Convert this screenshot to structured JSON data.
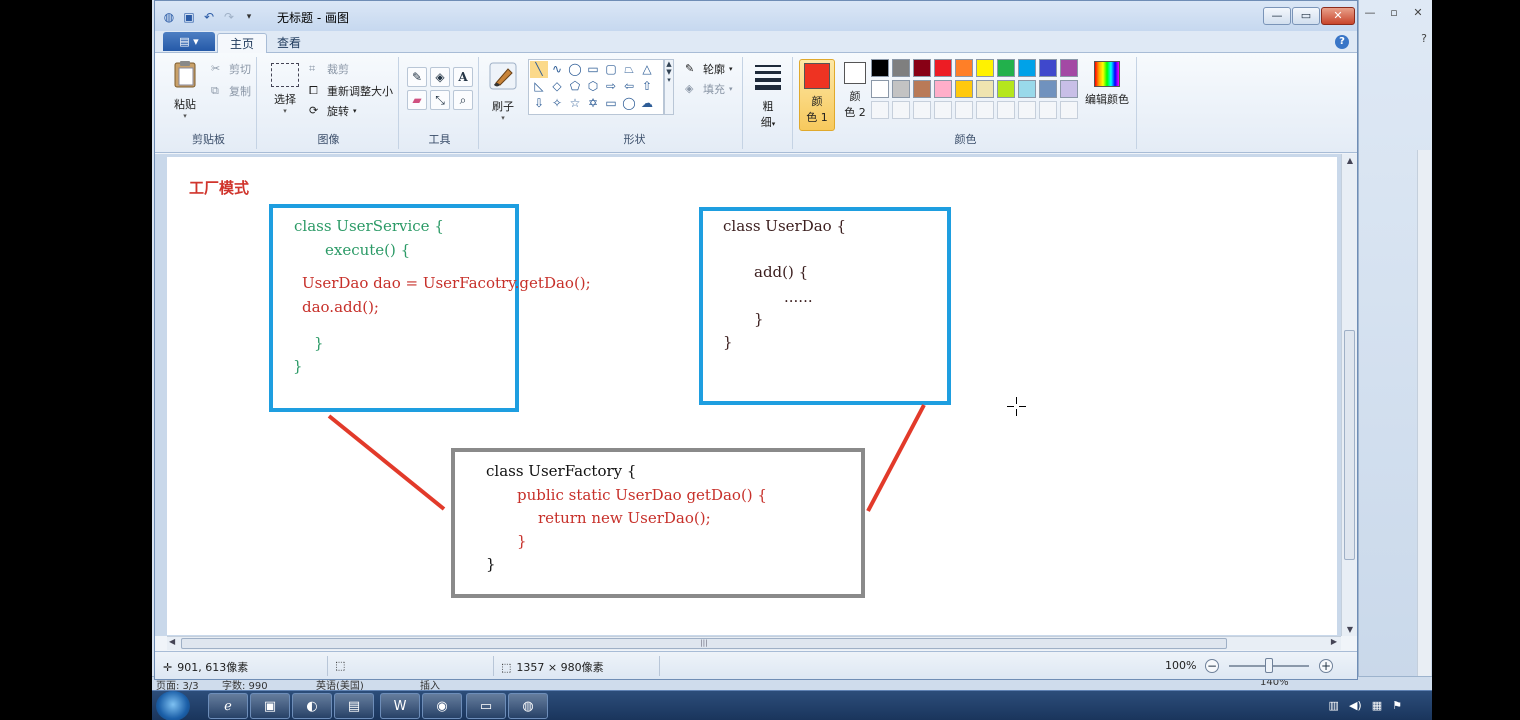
{
  "window": {
    "title": "无标题 - 画图",
    "qat_icons": [
      "paint-app-icon",
      "save-icon",
      "undo-icon",
      "redo-icon",
      "customize-qat-icon"
    ]
  },
  "tabs": [
    {
      "label": "主页",
      "active": true
    },
    {
      "label": "查看",
      "active": false
    }
  ],
  "ribbon": {
    "clipboard": {
      "paste": "粘贴",
      "cut": "剪切",
      "copy": "复制",
      "group": "剪贴板"
    },
    "image": {
      "select": "选择",
      "crop": "裁剪",
      "resize": "重新调整大小",
      "rotate": "旋转",
      "group": "图像"
    },
    "tools": {
      "group": "工具"
    },
    "brushes": {
      "label": "刷子"
    },
    "shapes": {
      "outline": "轮廓",
      "fill": "填充",
      "group": "形状"
    },
    "size": {
      "label_1": "粗",
      "label_2": "细"
    },
    "colors": {
      "color1_a": "颜",
      "color1_b": "色 1",
      "color2_a": "颜",
      "color2_b": "色 2",
      "edit": "编辑颜色",
      "group": "颜色",
      "color1": "#ee3322",
      "color2": "#ffffff",
      "palette_row1": [
        "#000000",
        "#7f7f7f",
        "#880015",
        "#ed1c24",
        "#ff7f27",
        "#fff200",
        "#22b14c",
        "#00a2e8",
        "#3f48cc",
        "#a349a4"
      ],
      "palette_row2": [
        "#ffffff",
        "#c3c3c3",
        "#b97a57",
        "#ffaec9",
        "#ffc90e",
        "#efe4b0",
        "#b5e61d",
        "#99d9ea",
        "#7092be",
        "#c8bfe7"
      ]
    }
  },
  "canvas": {
    "title": "工厂模式",
    "service_box": {
      "line1": "class UserService {",
      "line2": "execute() {",
      "line3": "UserDao dao = UserFacotry.getDao();",
      "line4": "dao.add();",
      "line5": "}",
      "line6": "}"
    },
    "dao_box": {
      "line1": "class UserDao {",
      "line2": "add() {",
      "line3": "......",
      "line4": "}",
      "line5": "}"
    },
    "factory_box": {
      "line1": "class UserFactory {",
      "line2": "public static UserDao getDao() {",
      "line3": "return new UserDao();",
      "line4": "}",
      "line5": "}"
    },
    "colors": {
      "blue_border": "#1e9ee0",
      "gray_border": "#8a8a8a",
      "connector": "#e23a2a"
    }
  },
  "status": {
    "cursor_pos": "901, 613像素",
    "image_size": "1357 × 980像素",
    "zoom": "100%"
  },
  "background_window": {
    "strip_left": "页面: 3/3",
    "strip_mid": "字数: 990",
    "strip_lang": "英语(美国)",
    "strip_insert": "插入",
    "strip_zoom": "140%"
  },
  "taskbar": {
    "apps": [
      "ie-icon",
      "intellij-icon",
      "eclipse-icon",
      "explorer-icon",
      "word-icon",
      "chrome-icon",
      "screen-icon",
      "paint-icon"
    ]
  }
}
